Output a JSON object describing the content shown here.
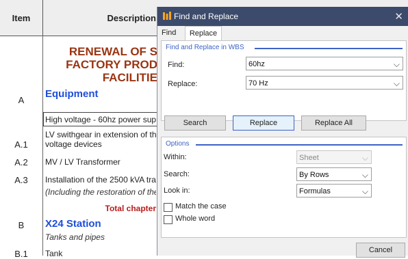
{
  "sheet": {
    "header": {
      "item": "Item",
      "description": "Description"
    },
    "title_lines": [
      "RENEWAL OF S",
      "FACTORY PROD",
      "FACILITIE"
    ],
    "rows": [
      {
        "item": "A",
        "text": "Equipment"
      },
      {
        "item": "",
        "text": "High voltage - 60hz power sup"
      },
      {
        "item": "",
        "text": "LV swithgear in extension of th"
      },
      {
        "item": "A.1",
        "text": "voltage devices"
      },
      {
        "item": "A.2",
        "text": "MV / LV Transformer"
      },
      {
        "item": "A.3",
        "text": "Installation of the 2500 kVA tra"
      },
      {
        "item": "",
        "text": "(Including the restoration of the"
      },
      {
        "item": "",
        "text": "Total chapter"
      },
      {
        "item": "B",
        "text": "X24 Station"
      },
      {
        "item": "",
        "text": "Tanks and pipes"
      },
      {
        "item": "B.1",
        "text": "Tank"
      }
    ]
  },
  "dialog": {
    "title": "Find and Replace",
    "close_icon": "close-icon",
    "tabs": [
      {
        "label": "Find"
      },
      {
        "label": "Replace",
        "active": true
      }
    ],
    "wbs_group": {
      "legend": "Find and Replace in WBS",
      "find_label": "Find:",
      "find_value": "60hz",
      "replace_label": "Replace:",
      "replace_value": "70 Hz"
    },
    "buttons": {
      "search": "Search",
      "replace": "Replace",
      "replace_all": "Replace All",
      "cancel": "Cancel"
    },
    "options": {
      "legend": "Options",
      "within_label": "Within:",
      "within_value": "Sheet",
      "search_label": "Search:",
      "search_value": "By Rows",
      "lookin_label": "Look in:",
      "lookin_value": "Formulas",
      "match_case": "Match the case",
      "whole_word": "Whole word"
    },
    "colors": {
      "titlebar": "#3c4a6b",
      "accent": "#3b62c4"
    }
  }
}
